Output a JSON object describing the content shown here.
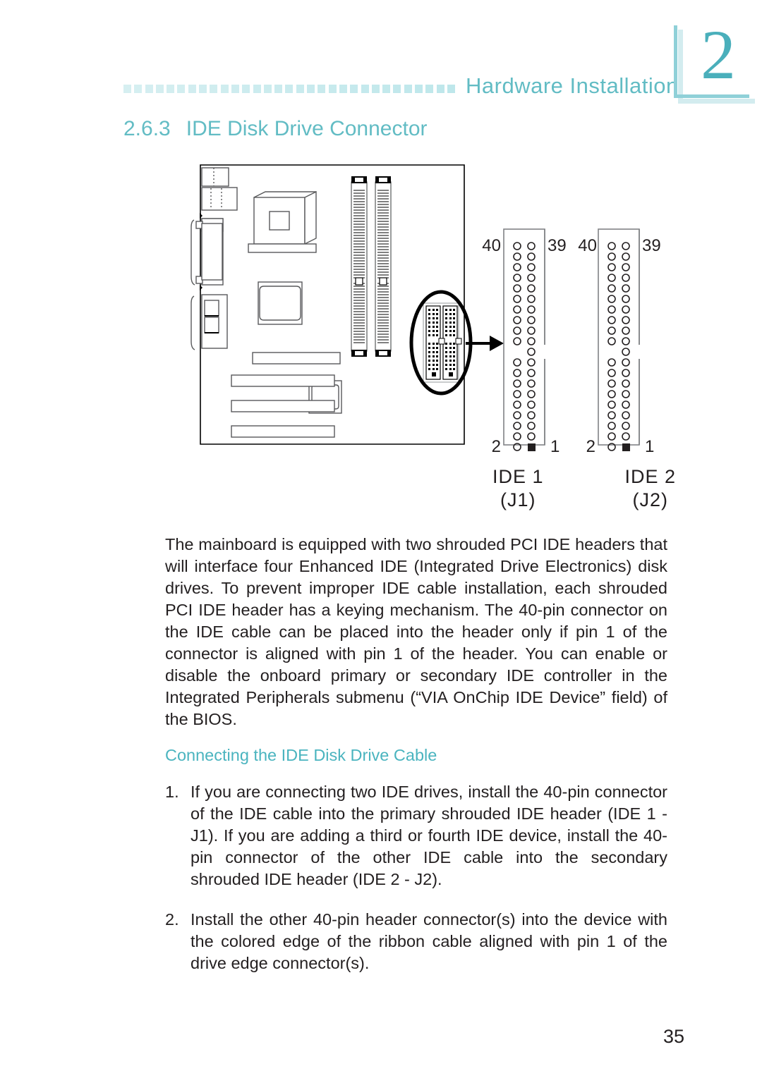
{
  "header": {
    "title": "Hardware Installation",
    "chapter_number": "2",
    "dot_count": 31
  },
  "section": {
    "number": "2.6.3",
    "title": "IDE Disk Drive Connector"
  },
  "figure": {
    "connector_1": {
      "top_left_label": "40",
      "top_right_label": "39",
      "bottom_left_label": "2",
      "bottom_right_label": "1",
      "caption_line1": "IDE 1",
      "caption_line2": "(J1)"
    },
    "connector_2": {
      "top_left_label": "40",
      "top_right_label": "39",
      "bottom_left_label": "2",
      "bottom_right_label": "1",
      "caption_line1": "IDE 2",
      "caption_line2": "(J2)"
    },
    "pin_rows": 20,
    "keyed_row_index": 10
  },
  "body": {
    "paragraph": "The mainboard is equipped with two shrouded PCI IDE headers that will interface four Enhanced IDE (Integrated Drive Electronics) disk drives. To prevent improper IDE cable installation, each shrouded PCI IDE header has a keying mechanism. The 40-pin connector on the IDE cable can be placed into the header only if pin 1 of the connector is aligned with pin 1 of the header. You can enable or disable the onboard primary or secondary IDE controller in the Integrated Peripherals submenu (“VIA OnChip IDE Device” field) of the BIOS."
  },
  "subsection": {
    "title": "Connecting the IDE Disk Drive Cable"
  },
  "steps": [
    {
      "marker": "1.",
      "text": "If you are connecting two IDE drives, install the 40-pin connector of the IDE cable into the primary shrouded IDE header (IDE 1 - J1). If you are adding a third or fourth IDE device, install the 40-pin connector of the other IDE cable into the secondary shrouded IDE  header (IDE 2 - J2)."
    },
    {
      "marker": "2.",
      "text": "Install the other 40-pin header connector(s) into the device with the colored edge of the ribbon cable aligned with pin 1 of the drive edge connector(s)."
    }
  ],
  "footer": {
    "page_number": "35"
  },
  "colors": {
    "accent_teal": "#62bcc4",
    "accent_teal_light": "#cdeaec",
    "chapter_num": "#4aafbb",
    "text": "#231f20"
  }
}
